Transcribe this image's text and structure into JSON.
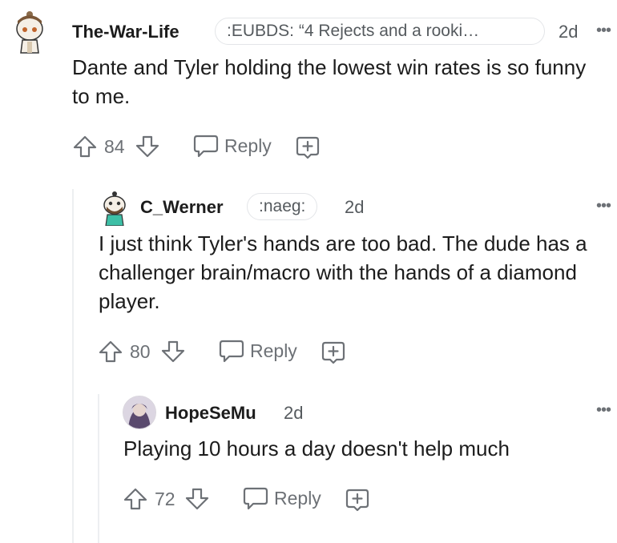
{
  "comments": [
    {
      "username": "The-War-Life",
      "flair": ":EUBDS: “4 Rejects and a rooki…",
      "time": "2d",
      "body": "Dante and Tyler holding the lowest win rates is so funny to me.",
      "votes": "84",
      "reply_label": "Reply"
    },
    {
      "username": "C_Werner",
      "flair": ":naeg:",
      "time": "2d",
      "body": "I just think Tyler's hands are too bad. The dude has a challenger brain/macro with the hands of a diamond player.",
      "votes": "80",
      "reply_label": "Reply"
    },
    {
      "username": "HopeSeMu",
      "time": "2d",
      "body": "Playing 10 hours a day doesn't help much",
      "votes": "72",
      "reply_label": "Reply"
    }
  ],
  "more_label": "•••",
  "colors": {
    "text": "#1c1c1c",
    "meta": "#555a5e",
    "icon": "#6d7176",
    "thread": "#edeff1"
  }
}
